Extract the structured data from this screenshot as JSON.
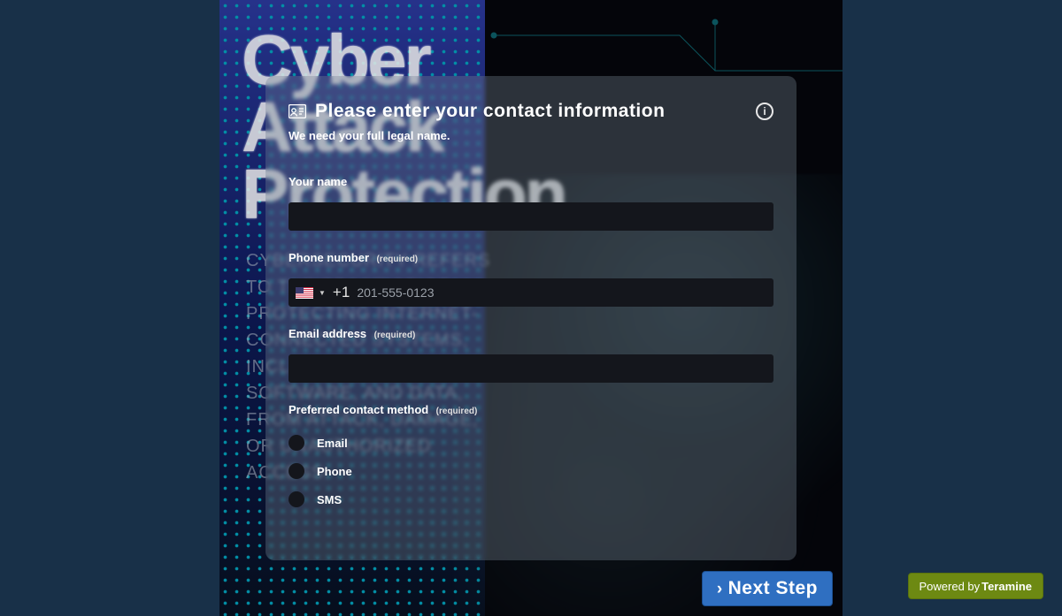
{
  "background": {
    "title_line1": "Cyber",
    "title_line2": "Attack",
    "title_line3": "Protection",
    "paragraph": "CYBERSECURITY REFERS TO THE PRACTICE OF PROTECTING INTERNET-CONNECTED SYSTEMS, INCLUDING HARDWARE, SOFTWARE, AND DATA, FROM ATTACK, DAMAGE, OR UNAUTHORIZED ACCESS."
  },
  "form": {
    "heading": "Please enter your contact information",
    "subtitle": "We need your full legal name.",
    "info_glyph": "i",
    "required_text": "(required)",
    "name": {
      "label": "Your name",
      "value": ""
    },
    "phone": {
      "label": "Phone number",
      "country_code": "+1",
      "placeholder": "201-555-0123",
      "value": ""
    },
    "email": {
      "label": "Email address",
      "value": ""
    },
    "contact_method": {
      "label": "Preferred contact method",
      "options": [
        "Email",
        "Phone",
        "SMS"
      ]
    }
  },
  "actions": {
    "next": "Next Step"
  },
  "footer": {
    "powered_prefix": "Powered by",
    "powered_brand": "Teramine"
  }
}
